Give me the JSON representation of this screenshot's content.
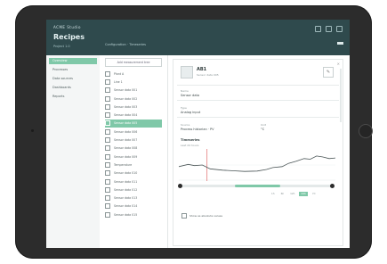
{
  "app": {
    "brand": "ACME Studio",
    "title": "Recipes",
    "subtitle": "Project 1.0",
    "breadcrumb": "Configuration · Timeseries"
  },
  "nav": {
    "items": [
      {
        "label": "Overview",
        "active": true
      },
      {
        "label": "Processes",
        "active": false
      },
      {
        "label": "Data sources",
        "active": false
      },
      {
        "label": "Dashboards",
        "active": false
      },
      {
        "label": "Reports",
        "active": false
      }
    ]
  },
  "tree": {
    "header": "Add measurement tree",
    "rows": [
      {
        "label": "Plant A"
      },
      {
        "label": "Line 1"
      },
      {
        "label": "Sensor data 001"
      },
      {
        "label": "Sensor data 002"
      },
      {
        "label": "Sensor data 003"
      },
      {
        "label": "Sensor data 004"
      },
      {
        "label": "Sensor data 005",
        "active": true
      },
      {
        "label": "Sensor data 006"
      },
      {
        "label": "Sensor data 007"
      },
      {
        "label": "Sensor data 008"
      },
      {
        "label": "Sensor data 009"
      },
      {
        "label": "Temperature"
      },
      {
        "label": "Sensor data 010"
      },
      {
        "label": "Sensor data 011"
      },
      {
        "label": "Sensor data 012"
      },
      {
        "label": "Sensor data 013"
      },
      {
        "label": "Sensor data 014"
      },
      {
        "label": "Sensor data 015"
      }
    ]
  },
  "detail": {
    "name": "AB1",
    "sub": "Sensor data 005",
    "edit_icon": "pencil-icon",
    "fields": {
      "label_1": "Name",
      "value_1": "Sensor data",
      "label_2": "Type",
      "value_2": "Analog input",
      "label_3": "Source",
      "value_3": "Process historian · PV",
      "label_4": "Unit",
      "value_4": "°C"
    },
    "section_title": "Timeseries",
    "section_sub": "Last 24 hours",
    "range_options": [
      "1h",
      "6h",
      "12h",
      "24h",
      "7d"
    ],
    "range_selected": "24h",
    "range_start": 0.36,
    "range_end": 0.66,
    "checkbox_label": "Show as absolute values",
    "chart_points": [
      [
        0.0,
        0.55
      ],
      [
        0.06,
        0.48
      ],
      [
        0.1,
        0.52
      ],
      [
        0.15,
        0.5
      ],
      [
        0.2,
        0.62
      ],
      [
        0.28,
        0.66
      ],
      [
        0.35,
        0.68
      ],
      [
        0.42,
        0.7
      ],
      [
        0.5,
        0.69
      ],
      [
        0.56,
        0.64
      ],
      [
        0.6,
        0.58
      ],
      [
        0.66,
        0.55
      ],
      [
        0.7,
        0.45
      ],
      [
        0.75,
        0.38
      ],
      [
        0.8,
        0.3
      ],
      [
        0.84,
        0.32
      ],
      [
        0.88,
        0.22
      ],
      [
        0.92,
        0.25
      ],
      [
        0.96,
        0.3
      ],
      [
        1.0,
        0.28
      ]
    ],
    "marker_x": 0.18
  },
  "colors": {
    "accent": "#7fc8a8",
    "topbar": "#2f4a4d"
  }
}
